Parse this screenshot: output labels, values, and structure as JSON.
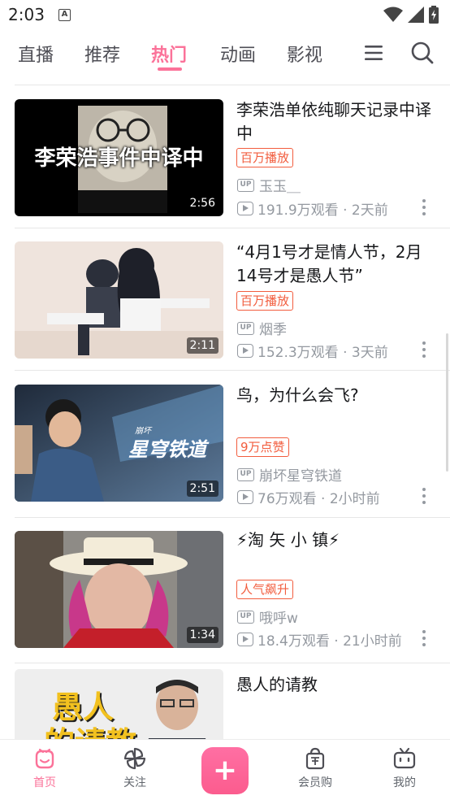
{
  "status_bar": {
    "time": "2:03",
    "notification_letter": "A"
  },
  "top_nav": {
    "tabs": [
      {
        "label": "直播"
      },
      {
        "label": "推荐"
      },
      {
        "label": "热门"
      },
      {
        "label": "动画"
      },
      {
        "label": "影视"
      }
    ],
    "active_tab": "热门",
    "icons": [
      "menu-icon",
      "search-icon"
    ]
  },
  "feed": [
    {
      "title": "李荣浩单依纯聊天记录中译中",
      "thumb_text": "李荣浩事件中译中",
      "duration": "2:56",
      "badge": "百万播放",
      "uploader": "玉玉＿",
      "stats": "191.9万观看 · 2天前"
    },
    {
      "title": "“4月1号才是情人节，2月14号才是愚人节”",
      "duration": "2:11",
      "badge": "百万播放",
      "uploader": "烟季",
      "stats": "152.3万观看 · 3天前"
    },
    {
      "title": "鸟，为什么会飞?",
      "thumb_text": "星穹铁道",
      "thumb_subtext": "崩坏",
      "duration": "2:51",
      "badge": "9万点赞",
      "uploader": "崩坏星穹铁道",
      "stats": "76万观看 · 2小时前"
    },
    {
      "title": "⚡淘 矢 小 镇⚡",
      "duration": "1:34",
      "badge": "人气飙升",
      "uploader": "哦呼w",
      "stats": "18.4万观看 · 21小时前"
    },
    {
      "title": "愚人的请教",
      "thumb_text": "愚人",
      "thumb_subtext": "的请教"
    }
  ],
  "bottom_bar": {
    "items": [
      {
        "label": "首页",
        "icon": "home-icon"
      },
      {
        "label": "关注",
        "icon": "pinwheel-icon"
      },
      {
        "label": "+",
        "icon": "publish-icon"
      },
      {
        "label": "会员购",
        "icon": "shopping-bag-icon"
      },
      {
        "label": "我的",
        "icon": "tv-icon"
      }
    ]
  },
  "colors": {
    "accent": "#fb7299",
    "badge": "#f25d3e",
    "meta": "#9499a0"
  }
}
